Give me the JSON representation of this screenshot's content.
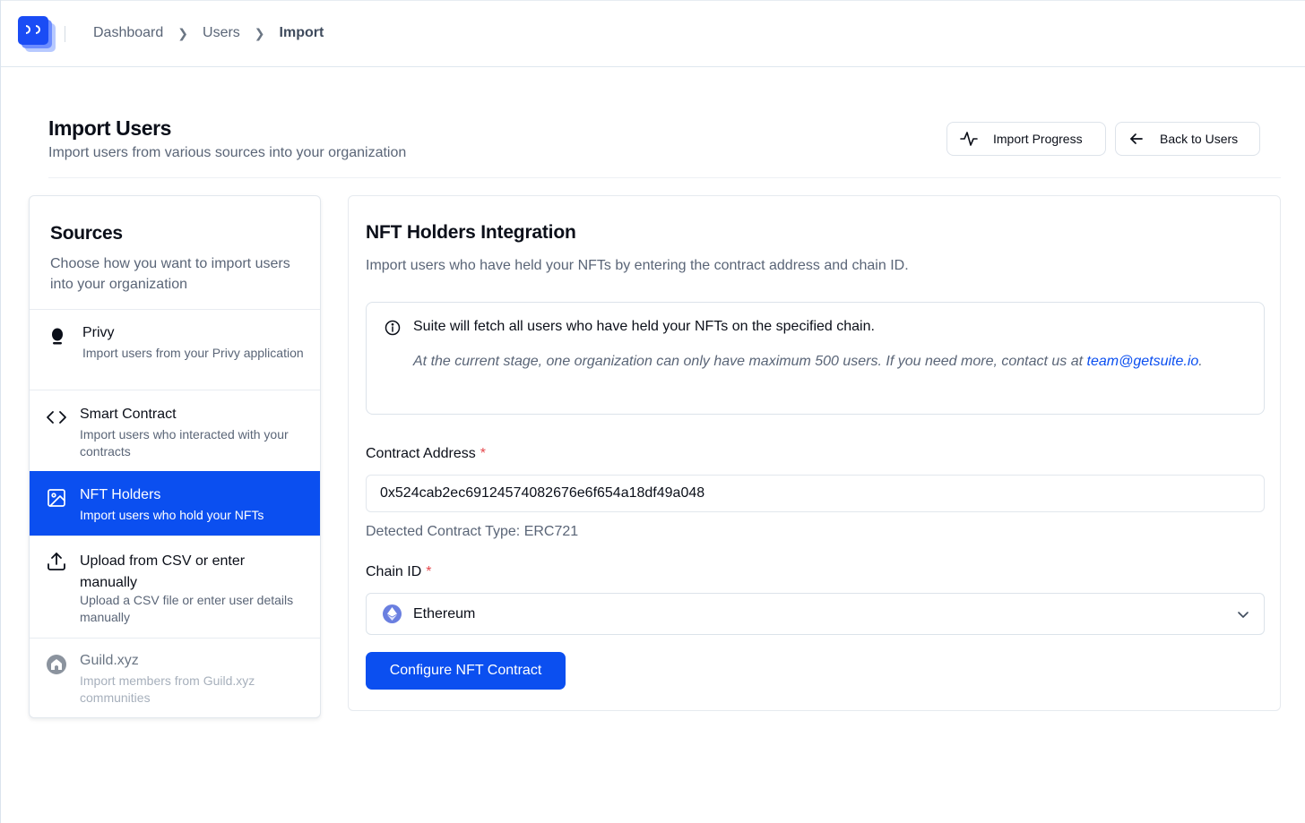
{
  "breadcrumb": {
    "items": [
      "Dashboard",
      "Users",
      "Import"
    ]
  },
  "header": {
    "title": "Import Users",
    "subtitle": "Import users from various sources into your organization",
    "import_progress_label": "Import Progress",
    "back_label": "Back to Users"
  },
  "sources": {
    "title": "Sources",
    "description": "Choose how you want to import users into your organization",
    "items": [
      {
        "name": "Privy",
        "desc": "Import users from your Privy application",
        "icon": "privy-icon",
        "state": "normal"
      },
      {
        "name": "Smart Contract",
        "desc": "Import users who interacted with your contracts",
        "icon": "code-icon",
        "state": "normal"
      },
      {
        "name": "NFT Holders",
        "desc": "Import users who hold your NFTs",
        "icon": "image-icon",
        "state": "active"
      },
      {
        "name": "Upload from CSV or enter manually",
        "desc": "Upload a CSV file or enter user details manually",
        "icon": "upload-icon",
        "state": "normal"
      },
      {
        "name": "Guild.xyz",
        "desc": "Import members from Guild.xyz communities",
        "icon": "guild-icon",
        "state": "disabled"
      }
    ]
  },
  "main": {
    "title": "NFT Holders Integration",
    "description": "Import users who have held your NFTs by entering the contract address and chain ID.",
    "info": {
      "text": "Suite will fetch all users who have held your NFTs on the specified chain.",
      "note": "At the current stage, one organization can only have maximum 500 users. If you need more, contact us at",
      "email": "team@getsuite.io",
      "note_end": "."
    },
    "contract_label": "Contract Address",
    "contract_value": "0x524cab2ec69124574082676e6f654a18df49a048",
    "detected_type": "Detected Contract Type: ERC721",
    "chain_label": "Chain ID",
    "chain_value": "Ethereum",
    "required_mark": "*",
    "submit_label": "Configure NFT Contract"
  },
  "colors": {
    "accent": "#0b4ff0",
    "required": "#e5484d",
    "muted_text": "#5a6577"
  }
}
